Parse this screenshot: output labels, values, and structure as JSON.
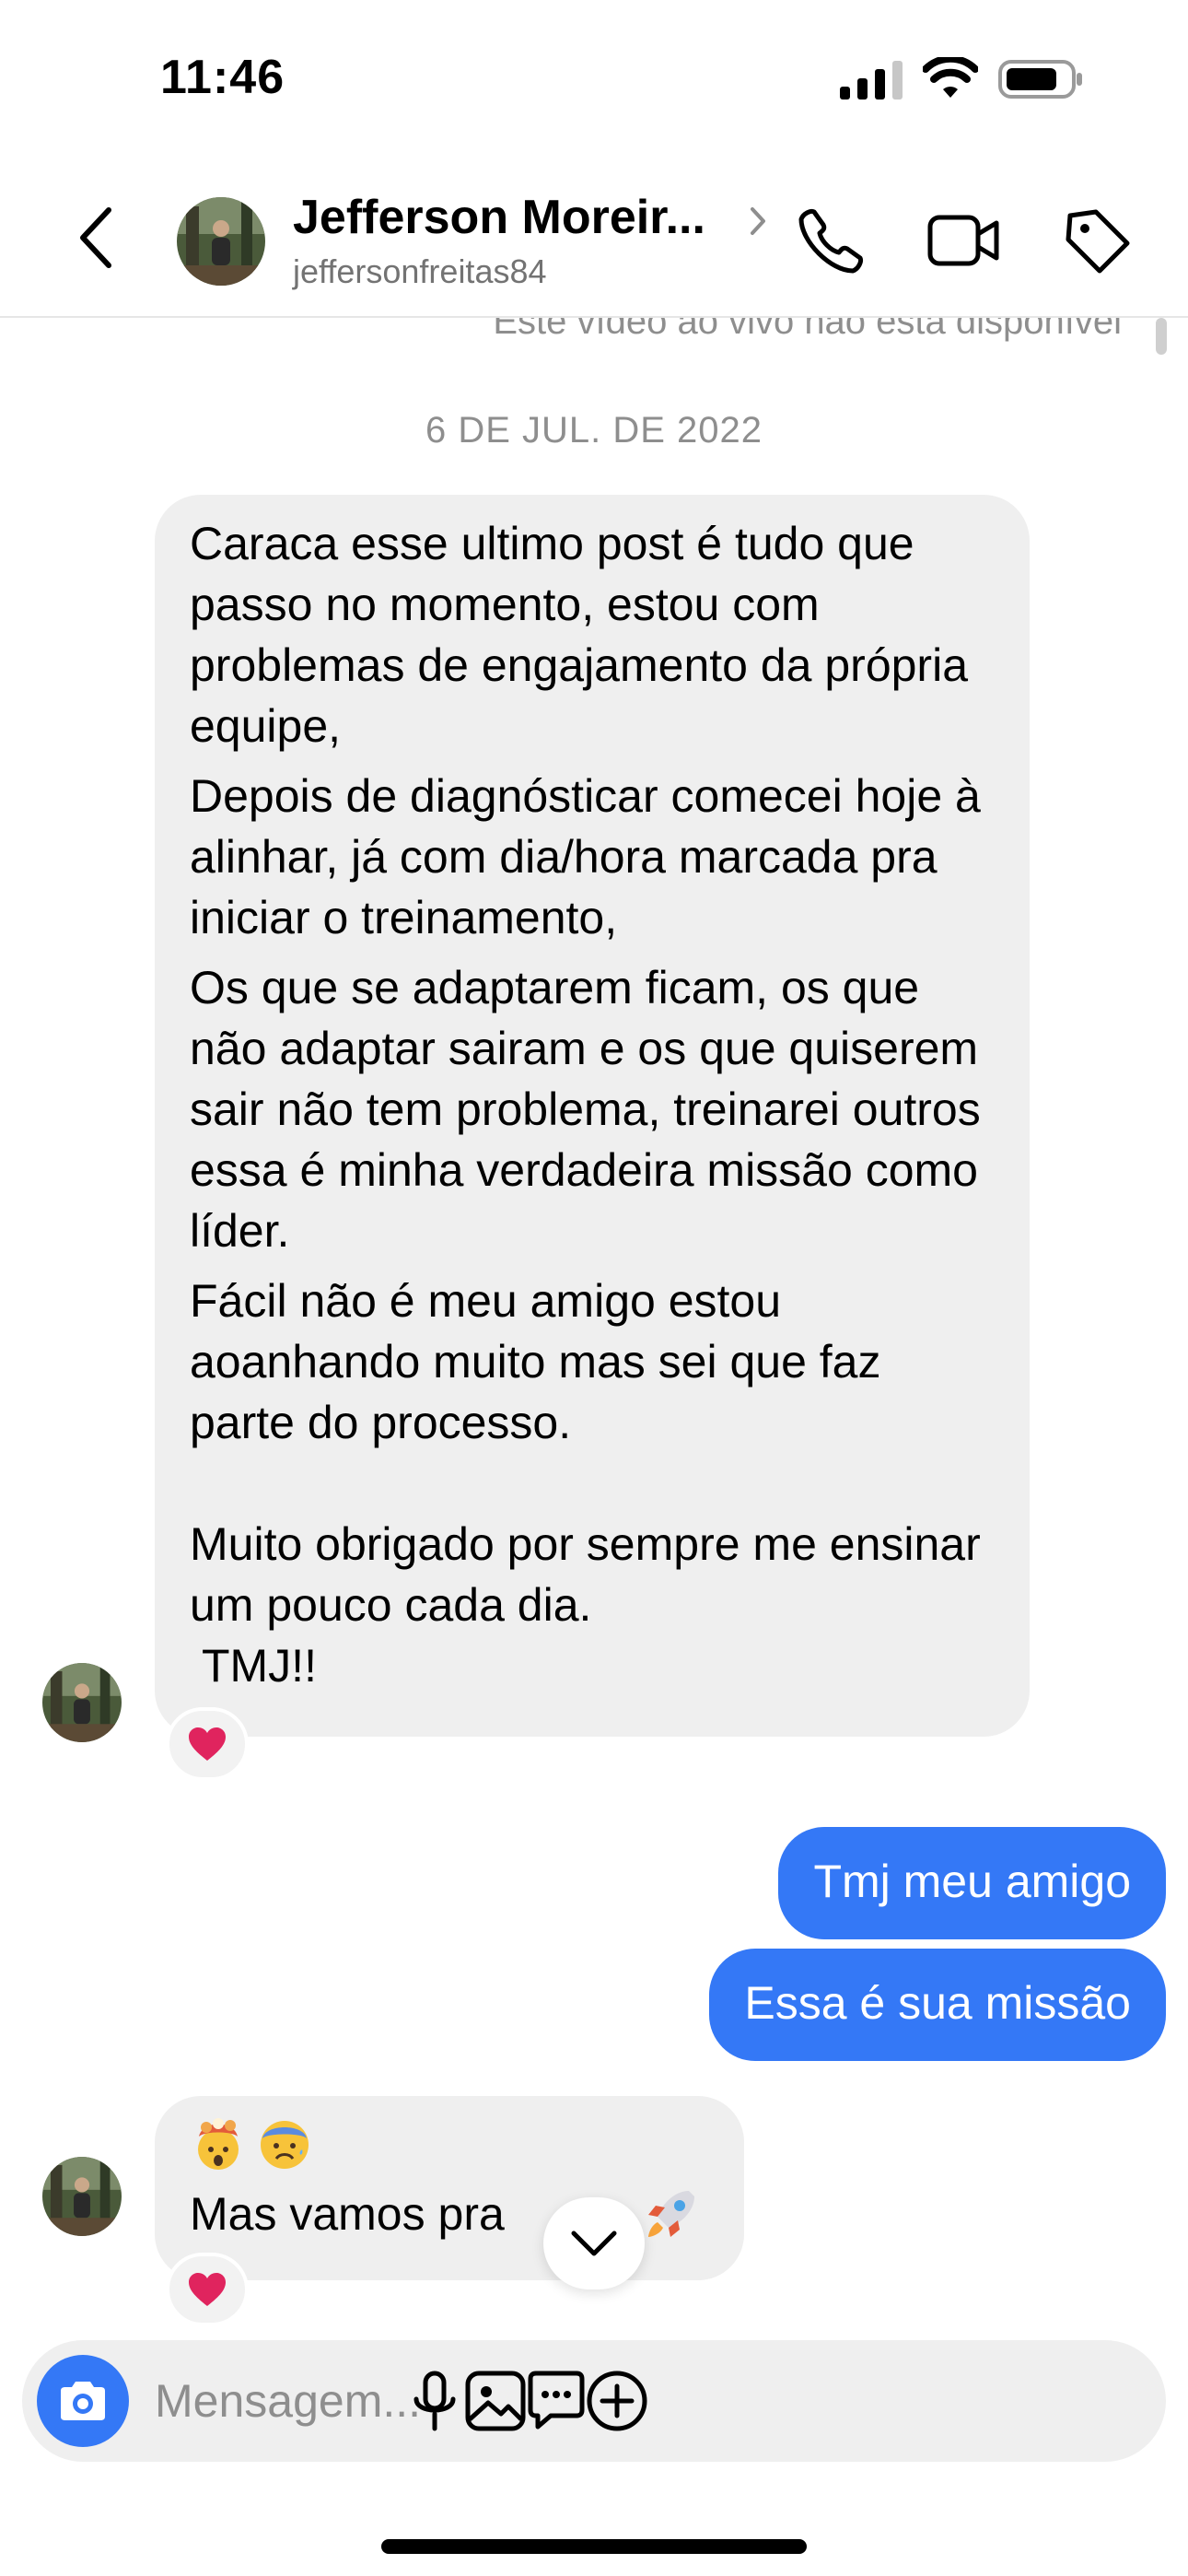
{
  "status_bar": {
    "time": "11:46",
    "signal_icon": "cellular-signal-icon",
    "wifi_icon": "wifi-icon",
    "battery_icon": "battery-icon"
  },
  "header": {
    "back_icon": "chevron-left-icon",
    "contact_name": "Jefferson Moreir...",
    "contact_handle": "jeffersonfreitas84",
    "call_icon": "phone-icon",
    "video_icon": "video-camera-icon",
    "tag_icon": "tag-icon"
  },
  "thread": {
    "unavailable_note": "Este vídeo ao vivo não está disponível",
    "date_separator": "6 DE JUL. DE 2022",
    "messages": [
      {
        "direction": "incoming",
        "paragraphs": [
          "Caraca esse ultimo post é  tudo que passo no momento, estou com problemas de engajamento da própria  equipe,",
          "Depois de diagnósticar comecei hoje à alinhar, já  com dia/hora marcada pra iniciar o treinamento,",
          "Os que se adaptarem ficam, os que não adaptar sairam e os que quiserem sair  não  tem problema, treinarei outros essa é  minha verdadeira  missão  como líder.",
          "Fácil  não  é  meu amigo estou aoanhando muito  mas sei que faz parte do processo.",
          "Muito obrigado  por sempre me ensinar um pouco cada dia.",
          " TMJ!!"
        ],
        "reaction": "heart"
      },
      {
        "direction": "outgoing",
        "text": "Tmj meu amigo"
      },
      {
        "direction": "outgoing",
        "text": "Essa é sua missão"
      },
      {
        "direction": "incoming",
        "emojis": [
          "exploding-head-emoji",
          "anxious-face-emoji"
        ],
        "text": "Mas vamos pra",
        "trailing_emoji": "rocket-emoji",
        "reaction": "heart"
      }
    ],
    "scroll_down_icon": "chevron-down-icon"
  },
  "composer": {
    "placeholder": "Mensagem...",
    "icons": [
      "camera-icon",
      "microphone-icon",
      "gallery-icon",
      "sticker-icon",
      "plus-icon"
    ]
  },
  "colors": {
    "outgoing_bubble": "#3478f6",
    "incoming_bubble": "#efefef",
    "accent": "#3478f6",
    "heart": "#e0245e"
  }
}
